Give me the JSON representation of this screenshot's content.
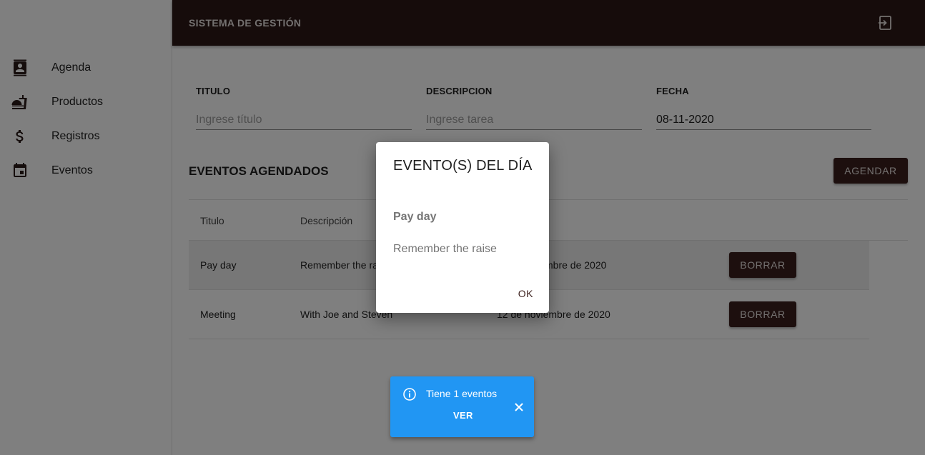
{
  "sidebar": {
    "items": [
      {
        "label": "Agenda",
        "icon": "contact-book-icon"
      },
      {
        "label": "Productos",
        "icon": "food-bell-icon"
      },
      {
        "label": "Registros",
        "icon": "dollar-icon"
      },
      {
        "label": "Eventos",
        "icon": "calendar-icon"
      }
    ]
  },
  "header": {
    "title": "SISTEMA DE GESTIÓN",
    "logout_icon": "logout-icon"
  },
  "form": {
    "title": {
      "label": "TITULO",
      "placeholder": "Ingrese título",
      "value": ""
    },
    "description": {
      "label": "DESCRIPCION",
      "placeholder": "Ingrese tarea",
      "value": ""
    },
    "date": {
      "label": "FECHA",
      "value": "08-11-2020"
    }
  },
  "events": {
    "section_title": "EVENTOS AGENDADOS",
    "schedule_button": "AGENDAR",
    "columns": [
      "Titulo",
      "Descripción"
    ],
    "rows": [
      {
        "title": "Pay day",
        "description": "Remember the ra",
        "date": "mbre de 2020",
        "action": "BORRAR"
      },
      {
        "title": "Meeting",
        "description": "With Joe and Steven",
        "date": "12 de noviembre de 2020",
        "action": "BORRAR"
      }
    ]
  },
  "dialog": {
    "title": "EVENTO(S) DEL DÍA",
    "event_title": "Pay day",
    "event_description": "Remember the raise",
    "ok_label": "OK"
  },
  "snackbar": {
    "message": "Tiene 1 eventos",
    "action": "VER",
    "color": "#2196f3"
  },
  "colors": {
    "primary": "#2c1816",
    "button": "#3b1f1c",
    "info": "#2196f3"
  }
}
